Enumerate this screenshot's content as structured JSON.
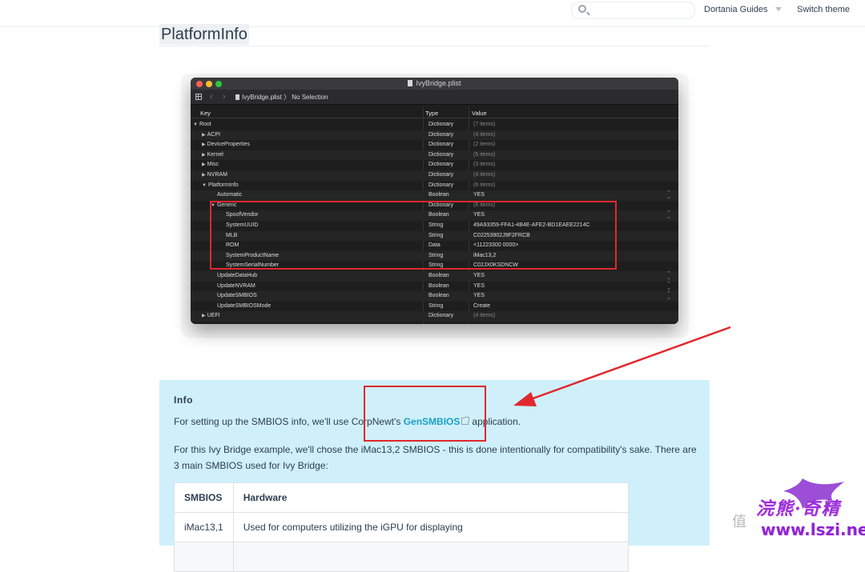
{
  "navbar": {
    "search_placeholder": "",
    "guides_label": "Dortania Guides",
    "theme_label": "Switch theme"
  },
  "heading": "PlatformInfo",
  "plist_window": {
    "title": "IvyBridge.plist",
    "path_file": "IvyBridge.plist",
    "path_sep": "〉",
    "path_selection": "No Selection",
    "columns": {
      "key": "Key",
      "type": "Type",
      "value": "Value"
    },
    "rows": [
      {
        "key": "Root",
        "type": "Dictionary",
        "value": "(7 items)",
        "indent": 0,
        "tri": "▼",
        "dim": true
      },
      {
        "key": "ACPI",
        "type": "Dictionary",
        "value": "(4 items)",
        "indent": 1,
        "tri": "▶",
        "dim": true
      },
      {
        "key": "DeviceProperties",
        "type": "Dictionary",
        "value": "(2 items)",
        "indent": 1,
        "tri": "▶",
        "dim": true
      },
      {
        "key": "Kernel",
        "type": "Dictionary",
        "value": "(5 items)",
        "indent": 1,
        "tri": "▶",
        "dim": true
      },
      {
        "key": "Misc",
        "type": "Dictionary",
        "value": "(3 items)",
        "indent": 1,
        "tri": "▶",
        "dim": true
      },
      {
        "key": "NVRAM",
        "type": "Dictionary",
        "value": "(4 items)",
        "indent": 1,
        "tri": "▶",
        "dim": true
      },
      {
        "key": "PlatformInfo",
        "type": "Dictionary",
        "value": "(6 items)",
        "indent": 1,
        "tri": "▼",
        "dim": true
      },
      {
        "key": "Automatic",
        "type": "Boolean",
        "value": "YES",
        "indent": 2,
        "tri": "",
        "stepper": true
      },
      {
        "key": "Generic",
        "type": "Dictionary",
        "value": "(6 items)",
        "indent": 2,
        "tri": "▼",
        "dim": true
      },
      {
        "key": "SpoofVendor",
        "type": "Boolean",
        "value": "YES",
        "indent": 3,
        "tri": "",
        "stepper": true
      },
      {
        "key": "SystemUUID",
        "type": "String",
        "value": "49A93359-FFA1-4B4E-AFE2-BD1EAEE2214C",
        "indent": 3,
        "tri": ""
      },
      {
        "key": "MLB",
        "type": "String",
        "value": "C02253902J9F2FRCB",
        "indent": 3,
        "tri": ""
      },
      {
        "key": "ROM",
        "type": "Data",
        "value": "<11223300 0000>",
        "indent": 3,
        "tri": ""
      },
      {
        "key": "SystemProductName",
        "type": "String",
        "value": "iMac13,2",
        "indent": 3,
        "tri": ""
      },
      {
        "key": "SystemSerialNumber",
        "type": "String",
        "value": "C02JX0KSDNCW",
        "indent": 3,
        "tri": ""
      },
      {
        "key": "UpdateDataHub",
        "type": "Boolean",
        "value": "YES",
        "indent": 2,
        "tri": "",
        "stepper": true
      },
      {
        "key": "UpdateNVRAM",
        "type": "Boolean",
        "value": "YES",
        "indent": 2,
        "tri": "",
        "stepper": true
      },
      {
        "key": "UpdateSMBIOS",
        "type": "Boolean",
        "value": "YES",
        "indent": 2,
        "tri": "",
        "stepper": true
      },
      {
        "key": "UpdateSMBIOSMode",
        "type": "String",
        "value": "Create",
        "indent": 2,
        "tri": ""
      },
      {
        "key": "UEFI",
        "type": "Dictionary",
        "value": "(4 items)",
        "indent": 1,
        "tri": "▶",
        "dim": true
      }
    ]
  },
  "info": {
    "title": "Info",
    "p1_before": "For setting up the SMBIOS info, we'll use CorpNewt's ",
    "p1_link": "GenSMBIOS",
    "p1_after": "application.",
    "p2": "For this Ivy Bridge example, we'll chose the iMac13,2 SMBIOS - this is done intentionally for compatibility's sake. There are 3 main SMBIOS used for Ivy Bridge:",
    "table": {
      "headers": [
        "SMBIOS",
        "Hardware"
      ],
      "rows": [
        [
          "iMac13,1",
          "Used for computers utilizing the iGPU for displaying"
        ]
      ]
    }
  },
  "watermark": {
    "mark": "值",
    "brand": "浣熊·奇精",
    "url": "www.lszi.net"
  },
  "colors": {
    "annotation_red": "#e0282e",
    "info_bg": "#cff0fb",
    "link": "#1a9fc7"
  }
}
